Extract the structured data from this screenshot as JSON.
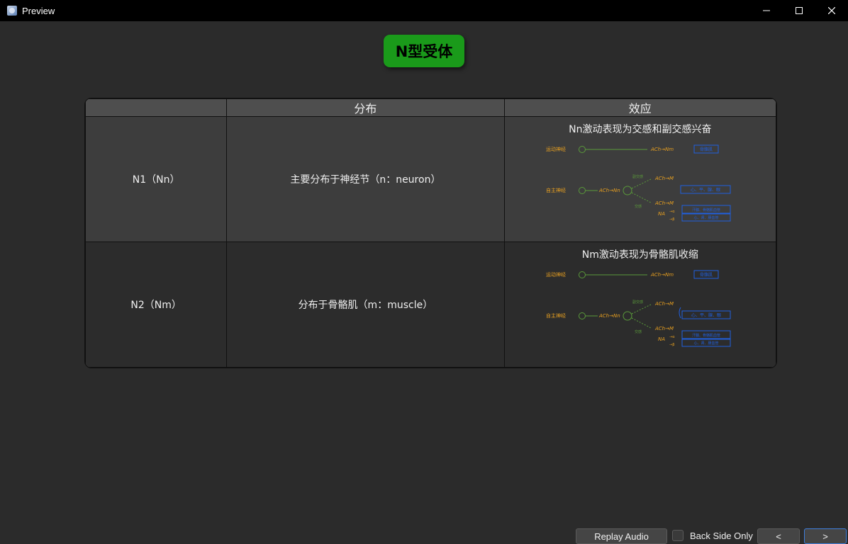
{
  "window": {
    "title": "Preview"
  },
  "card": {
    "title": "N型受体",
    "headers": [
      "",
      "分布",
      "效应"
    ],
    "rows": [
      {
        "receptor": "N1（Nn）",
        "distribution": "主要分布于神经节（n：neuron）",
        "effect_title": "Nn激动表现为交感和副交感兴奋",
        "diagram": {
          "motor_nerve": "运动神经",
          "autonomic_nerve": "自主神经",
          "ach_nm": "ACh→Nm",
          "ach_nn": "ACh→Nn",
          "ach_m": "ACh→M",
          "na": "NA",
          "alpha": "→α",
          "beta": "→β",
          "parasympathetic": "副交感",
          "sympathetic": "交感",
          "target_skeletal": "骨骼肌",
          "target_heart": "心、平、腺、眼",
          "target_sweat": "汗腺、骨骼肌血管",
          "target_vessel": "心、肾、肠血管"
        }
      },
      {
        "receptor": "N2（Nm）",
        "distribution": "分布于骨骼肌（m：muscle）",
        "effect_title": "Nm激动表现为骨骼肌收缩",
        "diagram": {
          "motor_nerve": "运动神经",
          "autonomic_nerve": "自主神经",
          "ach_nm": "ACh→Nm",
          "ach_nn": "ACh→Nn",
          "ach_m": "ACh→M",
          "na": "NA",
          "alpha": "→α",
          "beta": "→β",
          "parasympathetic": "副交感",
          "sympathetic": "交感",
          "target_skeletal": "骨骼肌",
          "target_heart": "心、平、腺、眼",
          "target_sweat": "汗腺、骨骼肌血管",
          "target_vessel": "心、肾、肠血管"
        }
      }
    ]
  },
  "controls": {
    "replay_label": "Replay Audio",
    "back_side_label": "Back Side Only",
    "prev_label": "<",
    "next_label": ">"
  },
  "colors": {
    "title_bg": "#1a9a1a",
    "label_orange": "#e8a020",
    "line_green": "#5a9a3a",
    "box_blue": "#2060e0"
  }
}
